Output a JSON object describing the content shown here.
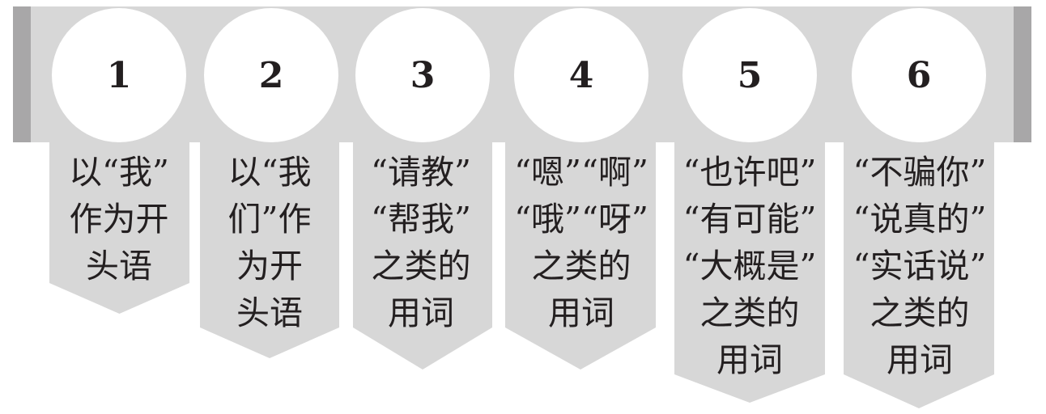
{
  "colors": {
    "band": "#d7d7d7",
    "band_caps": "#a8a7a8",
    "circle": "#ffffff",
    "text": "#231f20"
  },
  "steps": [
    {
      "number": "1",
      "lines": [
        "以“我”",
        "作为开",
        "头语"
      ]
    },
    {
      "number": "2",
      "lines": [
        "以“我",
        "们”作",
        "为开",
        "头语"
      ]
    },
    {
      "number": "3",
      "lines": [
        "“请教”",
        "“帮我”",
        "之类的",
        "用词"
      ]
    },
    {
      "number": "4",
      "lines": [
        "“嗯”“啊”",
        "“哦”“呀”",
        "之类的",
        "用词"
      ]
    },
    {
      "number": "5",
      "lines": [
        "“也许吧”",
        "“有可能”",
        "“大概是”",
        "之类的",
        "用词"
      ]
    },
    {
      "number": "6",
      "lines": [
        "“不骗你”",
        "“说真的”",
        "“实话说”",
        "之类的",
        "用词"
      ]
    }
  ]
}
